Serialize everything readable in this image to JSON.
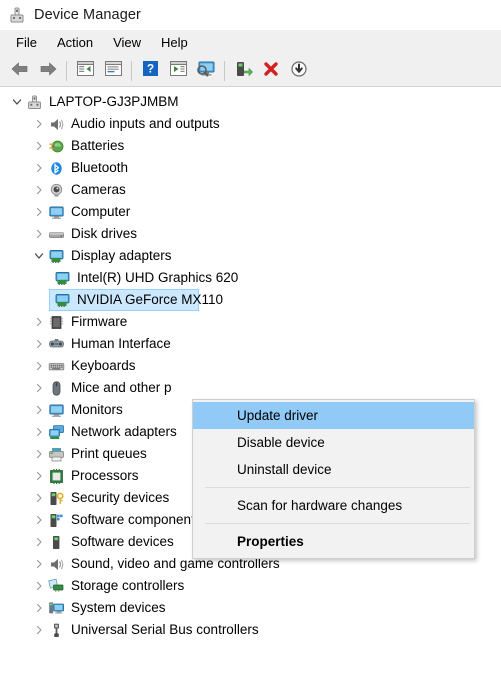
{
  "window": {
    "title": "Device Manager",
    "app_icon": "device-manager-icon"
  },
  "menubar": {
    "items": [
      {
        "label": "File",
        "name": "menu-file"
      },
      {
        "label": "Action",
        "name": "menu-action"
      },
      {
        "label": "View",
        "name": "menu-view"
      },
      {
        "label": "Help",
        "name": "menu-help"
      }
    ]
  },
  "toolbar": {
    "buttons": [
      {
        "icon": "back-arrow-icon",
        "name": "toolbar-back"
      },
      {
        "icon": "forward-arrow-icon",
        "name": "toolbar-forward"
      },
      {
        "icon": "show-hide-console-tree-icon",
        "name": "toolbar-console-tree"
      },
      {
        "icon": "properties-window-icon",
        "name": "toolbar-properties"
      },
      {
        "icon": "help-question-icon",
        "name": "toolbar-help"
      },
      {
        "icon": "action-window-icon",
        "name": "toolbar-action-pane"
      },
      {
        "icon": "scan-monitor-icon",
        "name": "toolbar-scan-hardware"
      },
      {
        "icon": "update-driver-icon",
        "name": "toolbar-update-driver"
      },
      {
        "icon": "uninstall-red-x-icon",
        "name": "toolbar-uninstall-device"
      },
      {
        "icon": "disable-download-arrow-icon",
        "name": "toolbar-disable-device"
      }
    ]
  },
  "tree": {
    "nodes": [
      {
        "label": "LAPTOP-GJ3PJMBM",
        "depth": 0,
        "twisty": "expanded",
        "icon": "computer-root-icon",
        "selected": false
      },
      {
        "label": "Audio inputs and outputs",
        "depth": 1,
        "twisty": "collapsed",
        "icon": "speaker-icon",
        "selected": false
      },
      {
        "label": "Batteries",
        "depth": 1,
        "twisty": "collapsed",
        "icon": "battery-icon",
        "selected": false
      },
      {
        "label": "Bluetooth",
        "depth": 1,
        "twisty": "collapsed",
        "icon": "bluetooth-icon",
        "selected": false
      },
      {
        "label": "Cameras",
        "depth": 1,
        "twisty": "collapsed",
        "icon": "camera-icon",
        "selected": false
      },
      {
        "label": "Computer",
        "depth": 1,
        "twisty": "collapsed",
        "icon": "monitor-icon",
        "selected": false
      },
      {
        "label": "Disk drives",
        "depth": 1,
        "twisty": "collapsed",
        "icon": "disk-drive-icon",
        "selected": false
      },
      {
        "label": "Display adapters",
        "depth": 1,
        "twisty": "expanded",
        "icon": "display-adapter-icon",
        "selected": false
      },
      {
        "label": "Intel(R) UHD Graphics 620",
        "depth": 2,
        "twisty": "none",
        "icon": "display-adapter-icon",
        "selected": false
      },
      {
        "label": "NVIDIA GeForce MX110",
        "depth": 2,
        "twisty": "none",
        "icon": "display-adapter-icon",
        "selected": true
      },
      {
        "label": "Firmware",
        "depth": 1,
        "twisty": "collapsed",
        "icon": "firmware-chip-icon",
        "selected": false
      },
      {
        "label": "Human Interface",
        "depth": 1,
        "twisty": "collapsed",
        "icon": "human-interface-icon",
        "selected": false
      },
      {
        "label": "Keyboards",
        "depth": 1,
        "twisty": "collapsed",
        "icon": "keyboard-icon",
        "selected": false
      },
      {
        "label": "Mice and other p",
        "depth": 1,
        "twisty": "collapsed",
        "icon": "mouse-icon",
        "selected": false
      },
      {
        "label": "Monitors",
        "depth": 1,
        "twisty": "collapsed",
        "icon": "monitor-icon",
        "selected": false
      },
      {
        "label": "Network adapters",
        "depth": 1,
        "twisty": "collapsed",
        "icon": "network-adapter-icon",
        "selected": false
      },
      {
        "label": "Print queues",
        "depth": 1,
        "twisty": "collapsed",
        "icon": "printer-icon",
        "selected": false
      },
      {
        "label": "Processors",
        "depth": 1,
        "twisty": "collapsed",
        "icon": "processor-icon",
        "selected": false
      },
      {
        "label": "Security devices",
        "depth": 1,
        "twisty": "collapsed",
        "icon": "security-device-icon",
        "selected": false
      },
      {
        "label": "Software components",
        "depth": 1,
        "twisty": "collapsed",
        "icon": "software-component-icon",
        "selected": false
      },
      {
        "label": "Software devices",
        "depth": 1,
        "twisty": "collapsed",
        "icon": "software-device-icon",
        "selected": false
      },
      {
        "label": "Sound, video and game controllers",
        "depth": 1,
        "twisty": "collapsed",
        "icon": "speaker-icon",
        "selected": false
      },
      {
        "label": "Storage controllers",
        "depth": 1,
        "twisty": "collapsed",
        "icon": "storage-controller-icon",
        "selected": false
      },
      {
        "label": "System devices",
        "depth": 1,
        "twisty": "collapsed",
        "icon": "system-device-icon",
        "selected": false
      },
      {
        "label": "Universal Serial Bus controllers",
        "depth": 1,
        "twisty": "collapsed",
        "icon": "usb-icon",
        "selected": false
      }
    ]
  },
  "context_menu": {
    "items": [
      {
        "label": "Update driver",
        "type": "item",
        "highlight": true,
        "bold": false,
        "name": "context-update-driver"
      },
      {
        "label": "Disable device",
        "type": "item",
        "highlight": false,
        "bold": false,
        "name": "context-disable-device"
      },
      {
        "label": "Uninstall device",
        "type": "item",
        "highlight": false,
        "bold": false,
        "name": "context-uninstall-device"
      },
      {
        "type": "separator"
      },
      {
        "label": "Scan for hardware changes",
        "type": "item",
        "highlight": false,
        "bold": false,
        "name": "context-scan-hardware-changes"
      },
      {
        "type": "separator"
      },
      {
        "label": "Properties",
        "type": "item",
        "highlight": false,
        "bold": true,
        "name": "context-properties"
      }
    ]
  },
  "colors": {
    "selection_fill": "#cce8ff",
    "menu_highlight": "#91c9f7",
    "chrome_bg": "#f0f0f0",
    "menu_bg": "#f2f2f2"
  }
}
